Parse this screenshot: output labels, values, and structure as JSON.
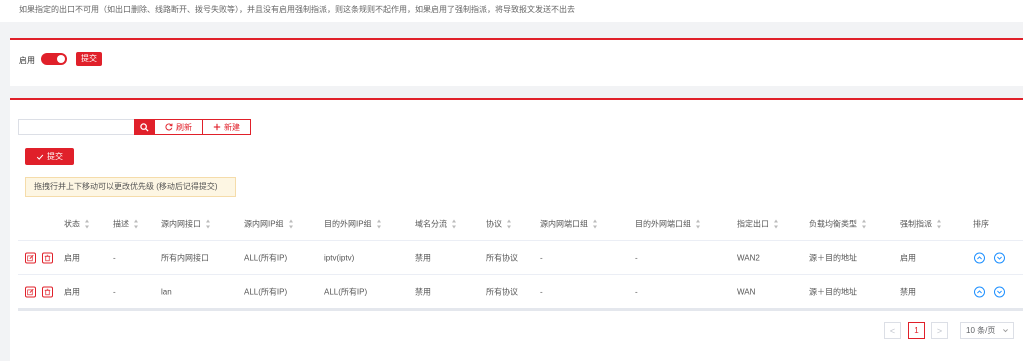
{
  "notice": "如果指定的出口不可用（如出口删除、线路断开、拨号失败等），并且没有启用强制指派，则这条规则不起作用，如果启用了强制指派，将导致报文发送不出去",
  "switch_panel": {
    "enable_label": "启用",
    "toggle_on": true,
    "submit_label": "提交"
  },
  "toolbar": {
    "search_value": "",
    "refresh_label": "刷新",
    "new_label": "新建",
    "submit_label": "提交"
  },
  "tip": "拖拽行并上下移动可以更改优先级 (移动后记得提交)",
  "table": {
    "headers": [
      "状态",
      "描述",
      "源内网接口",
      "源内网IP组",
      "目的外网IP组",
      "域名分流",
      "协议",
      "源内网端口组",
      "目的外网端口组",
      "指定出口",
      "负载均衡类型",
      "强制指派",
      "排序"
    ],
    "rows": [
      [
        "启用",
        "-",
        "所有内网接口",
        "ALL(所有IP)",
        "iptv(iptv)",
        "禁用",
        "所有协议",
        "-",
        "-",
        "WAN2",
        "源＋目的地址",
        "启用"
      ],
      [
        "启用",
        "-",
        "lan",
        "ALL(所有IP)",
        "ALL(所有IP)",
        "禁用",
        "所有协议",
        "-",
        "-",
        "WAN",
        "源＋目的地址",
        "禁用"
      ]
    ]
  },
  "pagination": {
    "prev": "<",
    "current_page": "1",
    "next": ">",
    "page_size": "10 条/页"
  },
  "colors": {
    "accent": "#e0202a",
    "sort_button": "#1e90ff"
  }
}
